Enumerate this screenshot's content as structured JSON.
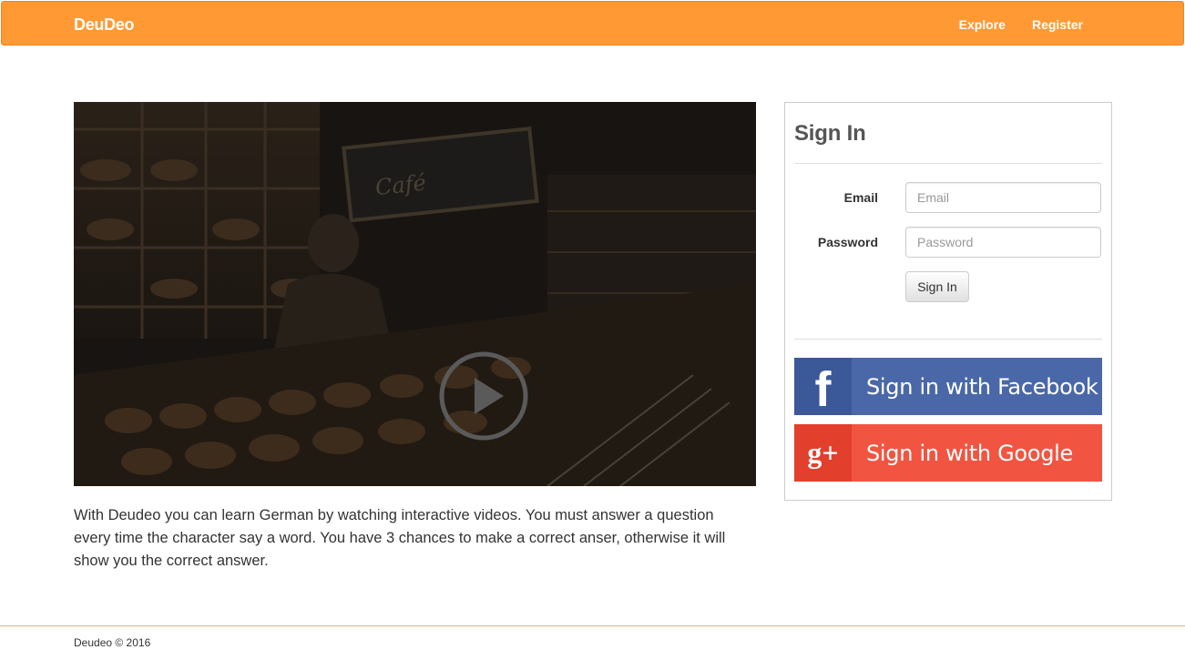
{
  "navbar": {
    "brand": "DeuDeo",
    "links": [
      "Explore",
      "Register"
    ],
    "background_color": "#ff9933"
  },
  "video": {
    "play_icon": "play-circle-icon"
  },
  "intro_text": "With Deudeo you can learn German by watching interactive videos. You must answer a question every time the character say a word. You have 3 chances to make a correct anser, otherwise it will show you the correct answer.",
  "signin": {
    "title": "Sign In",
    "email_label": "Email",
    "email_placeholder": "Email",
    "password_label": "Password",
    "password_placeholder": "Password",
    "submit_label": "Sign In",
    "facebook": {
      "icon": "facebook-icon",
      "icon_glyph": "f",
      "label": "Sign in with Facebook",
      "color": "#4a68a8"
    },
    "google": {
      "icon": "google-plus-icon",
      "icon_glyph": "g+",
      "label": "Sign in with Google",
      "color": "#f15541"
    }
  },
  "footer": {
    "text": "Deudeo © 2016"
  }
}
